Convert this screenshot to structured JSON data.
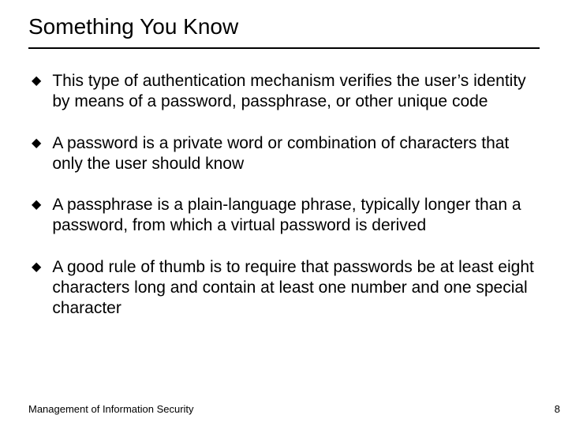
{
  "title": "Something You Know",
  "bullets": [
    "This type of authentication mechanism verifies the user’s identity by means of a password, passphrase, or other unique code",
    "A password is a private word or combination of characters that only the user should know",
    "A passphrase is a plain-language phrase, typically longer than a password, from which a virtual password is derived",
    "A good rule of thumb is to require that passwords be at least eight characters long and contain at least one number and one special character"
  ],
  "footer": "Management of Information Security",
  "page_number": "8"
}
